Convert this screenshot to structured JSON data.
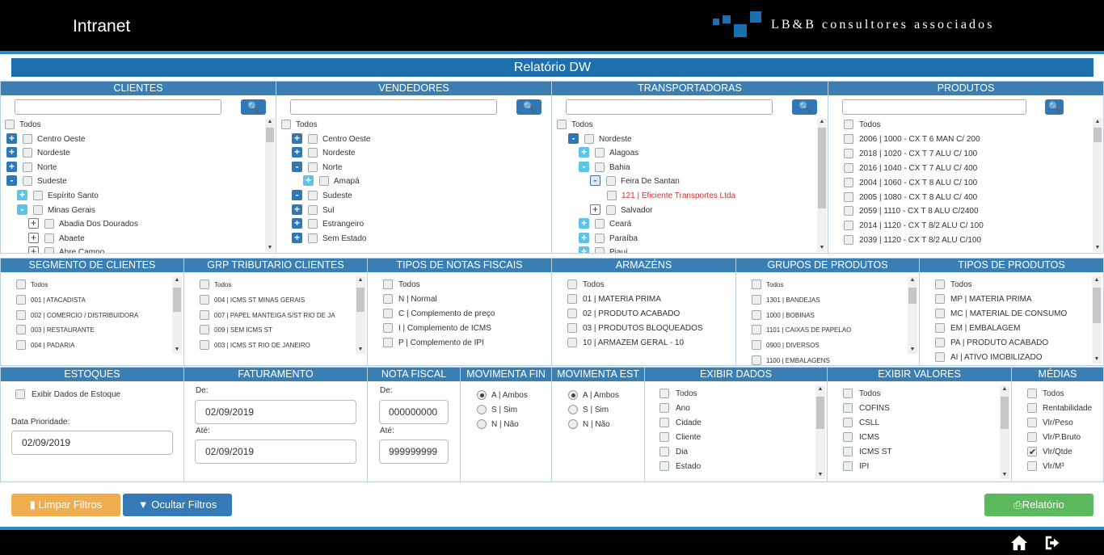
{
  "app": {
    "title": "Intranet",
    "logo_text": "LB&B consultores associados",
    "report_title": "Relatório DW"
  },
  "clientes": {
    "header": "CLIENTES",
    "items": [
      {
        "label": "Todos",
        "toggle": ""
      },
      {
        "label": "Centro Oeste",
        "toggle": "+"
      },
      {
        "label": "Nordeste",
        "toggle": "+"
      },
      {
        "label": "Norte",
        "toggle": "+"
      },
      {
        "label": "Sudeste",
        "toggle": "-"
      },
      {
        "label": "Espírito Santo",
        "toggle": "+"
      },
      {
        "label": "Minas Gerais",
        "toggle": "-"
      },
      {
        "label": "Abadia Dos Dourados",
        "toggle": "+"
      },
      {
        "label": "Abaete",
        "toggle": "+"
      },
      {
        "label": "Abre Campo",
        "toggle": "+"
      }
    ]
  },
  "vendedores": {
    "header": "VENDEDORES",
    "items": [
      {
        "label": "Todos",
        "toggle": ""
      },
      {
        "label": "Centro Oeste",
        "toggle": "+"
      },
      {
        "label": "Nordeste",
        "toggle": "+"
      },
      {
        "label": "Norte",
        "toggle": "-"
      },
      {
        "label": "Amapá",
        "toggle": "+"
      },
      {
        "label": "Sudeste",
        "toggle": "-"
      },
      {
        "label": "Sul",
        "toggle": "+"
      },
      {
        "label": "Estrangeiro",
        "toggle": "+"
      },
      {
        "label": "Sem Estado",
        "toggle": "+"
      }
    ]
  },
  "transportadoras": {
    "header": "TRANSPORTADORAS",
    "items": [
      {
        "label": "Todos",
        "toggle": ""
      },
      {
        "label": "Nordeste",
        "toggle": "-"
      },
      {
        "label": "Alagoas",
        "toggle": "+"
      },
      {
        "label": "Bahia",
        "toggle": "-"
      },
      {
        "label": "Feira De Santan",
        "toggle": "-"
      },
      {
        "label": "121 | Eficiente Transportes Ltda",
        "toggle": ""
      },
      {
        "label": "Salvador",
        "toggle": "+"
      },
      {
        "label": "Ceará",
        "toggle": "+"
      },
      {
        "label": "Paraíba",
        "toggle": "+"
      },
      {
        "label": "Piauí",
        "toggle": "+"
      }
    ]
  },
  "produtos": {
    "header": "PRODUTOS",
    "items": [
      "Todos",
      "2006 | 1000 - CX T 6 MAN C/ 200",
      "2018 | 1020 - CX T 7 ALU C/ 100",
      "2016 | 1040 - CX T 7 ALU C/ 400",
      "2004 | 1060 - CX T 8 ALU C/ 100",
      "2005 | 1080 - CX T 8 ALU C/ 400",
      "2059 | 1110 - CX T 8 ALU C/2400",
      "2014 | 1120 - CX T 8/2 ALU C/ 100",
      "2039 | 1120 - CX T 8/2 ALU C/100"
    ]
  },
  "segmento": {
    "header": "SEGMENTO DE CLIENTES",
    "items": [
      "Todos",
      "001 | ATACADISTA",
      "002 | COMERCIO / DISTRIBUIDORA",
      "003 | RESTAURANTE",
      "004 | PADARIA"
    ]
  },
  "grp_tributario": {
    "header": "GRP TRIBUTARIO CLIENTES",
    "items": [
      "Todos",
      "004 | ICMS ST MINAS GERAIS",
      "007 | PAPEL MANTEIGA S/ST RIO DE JA",
      "009 | SEM ICMS ST",
      "003 | ICMS ST RIO DE JANEIRO"
    ]
  },
  "tipos_notas": {
    "header": "TIPOS DE NOTAS FISCAIS",
    "items": [
      "Todos",
      "N | Normal",
      "C | Complemento de preço",
      "I | Complemento de ICMS",
      "P | Complemento de IPI"
    ]
  },
  "armazens": {
    "header": "ARMAZÉNS",
    "items": [
      "Todos",
      "01 | MATERIA PRIMA",
      "02 | PRODUTO ACABADO",
      "03 | PRODUTOS BLOQUEADOS",
      "10 | ARMAZEM GERAL - 10"
    ]
  },
  "grupos_produtos": {
    "header": "GRUPOS DE PRODUTOS",
    "items": [
      "Todos",
      "1301 | BANDEJAS",
      "1000 | BOBINAS",
      "1101 | CAIXAS DE PAPELAO",
      "0900 | DIVERSOS",
      "1100 | EMBALAGENS"
    ]
  },
  "tipos_produtos": {
    "header": "TIPOS DE PRODUTOS",
    "items": [
      "Todos",
      "MP | MATERIA PRIMA",
      "MC | MATERIAL DE CONSUMO",
      "EM | EMBALAGEM",
      "PA | PRODUTO ACABADO",
      "AI | ATIVO IMOBILIZADO"
    ]
  },
  "estoques": {
    "header": "ESTOQUES",
    "checkbox_label": "Exibir Dados de Estoque",
    "date_label": "Data Prioridade:",
    "date_value": "02/09/2019"
  },
  "faturamento": {
    "header": "FATURAMENTO",
    "from_label": "De:",
    "from_value": "02/09/2019",
    "to_label": "Até:",
    "to_value": "02/09/2019"
  },
  "nota_fiscal": {
    "header": "NOTA FISCAL",
    "from_label": "De:",
    "from_value": "000000000",
    "to_label": "Até:",
    "to_value": "999999999"
  },
  "movimenta_fin": {
    "header": "MOVIMENTA FIN",
    "options": [
      "A | Ambos",
      "S | Sim",
      "N | Não"
    ],
    "selected": 0
  },
  "movimenta_est": {
    "header": "MOVIMENTA EST",
    "options": [
      "A | Ambos",
      "S | Sim",
      "N | Não"
    ],
    "selected": 0
  },
  "exibir_dados": {
    "header": "EXIBIR DADOS",
    "items": [
      "Todos",
      "Ano",
      "Cidade",
      "Cliente",
      "Dia",
      "Estado"
    ]
  },
  "exibir_valores": {
    "header": "EXIBIR VALORES",
    "items": [
      "Todos",
      "COFINS",
      "CSLL",
      "ICMS",
      "ICMS ST",
      "IPI"
    ]
  },
  "medias": {
    "header": "MÉDIAS",
    "items": [
      "Todos",
      "Rentabilidade",
      "Vlr/Peso",
      "Vlr/P.Bruto",
      "Vlr/Qtde",
      "Vlr/M³"
    ],
    "checked_index": 4
  },
  "buttons": {
    "limpar": "Limpar Filtros",
    "ocultar": "Ocultar Filtros",
    "relatorio": "Relatório"
  },
  "colors": {
    "header_blue": "#3a7fb4",
    "title_blue": "#1d6fad",
    "orange": "#f0ad4e",
    "blue_btn": "#337ab7",
    "green": "#5cb85c"
  },
  "icons": [
    "search-icon",
    "trash-icon",
    "filter-icon",
    "print-icon",
    "home-icon",
    "logout-icon"
  ]
}
